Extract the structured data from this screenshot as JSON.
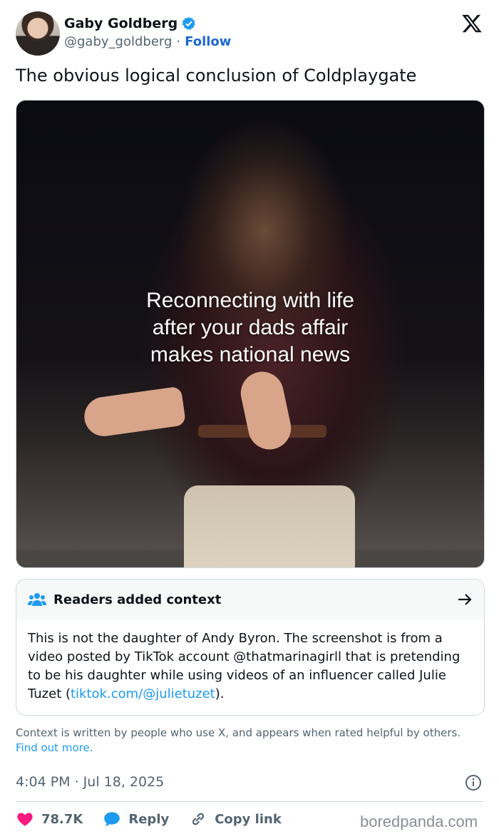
{
  "author": {
    "name": "Gaby Goldberg",
    "handle": "@gaby_goldberg",
    "separator": "·",
    "follow_label": "Follow"
  },
  "tweet": {
    "text": "The obvious logical conclusion of Coldplaygate",
    "media_caption": "Reconnecting with life\nafter your dads affair\nmakes national news"
  },
  "context": {
    "title": "Readers added context",
    "body_prefix": "This is not the daughter of Andy Byron. The screenshot is from a video posted by TikTok account @thatmarinagirll that is pretending to be his daughter while using videos of an influencer called Julie Tuzet (",
    "link_text": "tiktok.com/@julietuzet",
    "body_suffix": ").",
    "note": "Context is written by people who use X, and appears when rated helpful by others.",
    "find_more": "Find out more."
  },
  "meta": {
    "timestamp": "4:04 PM · Jul 18, 2025"
  },
  "actions": {
    "likes": "78.7K",
    "reply_label": "Reply",
    "copy_label": "Copy link"
  },
  "watermark": "boredpanda.com",
  "colors": {
    "accent": "#1d9bf0",
    "like": "#f91880",
    "follow": "#1d6ad2"
  }
}
